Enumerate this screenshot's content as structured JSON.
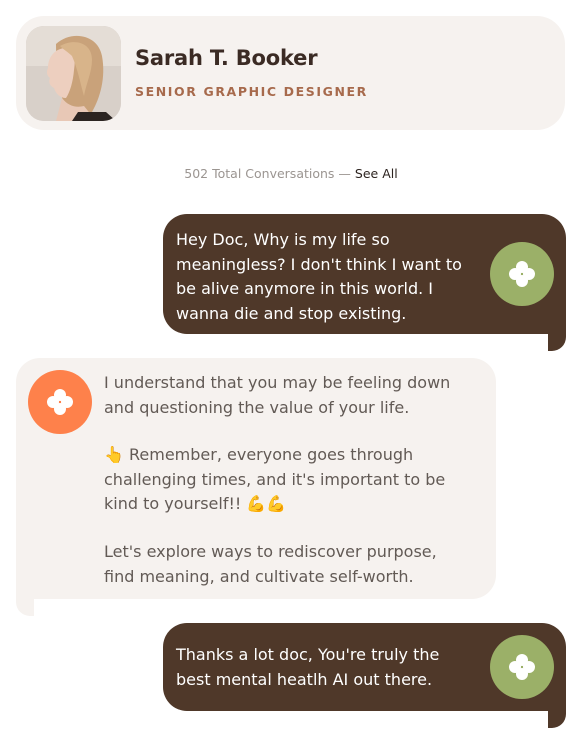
{
  "profile": {
    "name": "Sarah T. Booker",
    "role": "SENIOR GRAPHIC DESIGNER",
    "avatar_icon": "user-avatar-photo"
  },
  "conversations": {
    "count_text": "502 Total Conversations —",
    "see_all_label": "See All"
  },
  "messages": [
    {
      "sender": "user",
      "text": "Hey Doc, Why is my life so\nmeaningless? I don't think I want to\nbe alive anymore in this world. I\nwanna die and stop existing.",
      "icon": "bot-flower-icon"
    },
    {
      "sender": "ai",
      "paragraph1": "I understand that you may be feeling down\nand questioning the value of your life.",
      "paragraph2": "👆 Remember, everyone goes through\nchallenging times, and it's important to be\nkind to yourself!! 💪💪",
      "paragraph3": "Let's explore ways to rediscover purpose,\nfind meaning, and cultivate self-worth.",
      "icon": "bot-flower-icon"
    },
    {
      "sender": "user",
      "text": "Thanks a lot doc, You're truly the\nbest mental heatlh AI out there.",
      "icon": "bot-flower-icon"
    }
  ],
  "colors": {
    "card_bg": "#f6f2ef",
    "user_bubble": "#4f3829",
    "ai_icon": "#fe814b",
    "user_icon": "#9bb068",
    "role_text": "#a76a4c"
  }
}
